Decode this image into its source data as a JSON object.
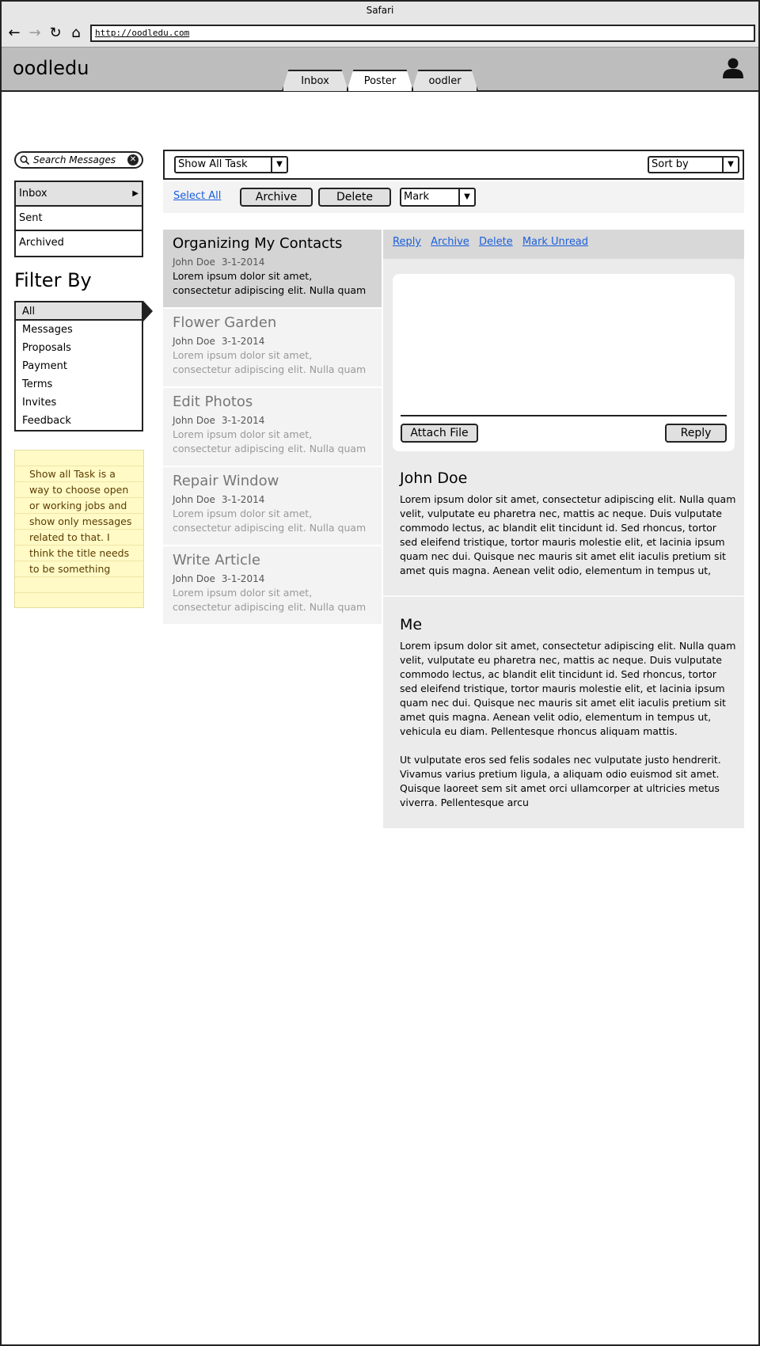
{
  "browser": {
    "window_title": "Safari",
    "url": "http://oodledu.com"
  },
  "app": {
    "logo": "oodledu",
    "tabs": [
      {
        "label": "Inbox"
      },
      {
        "label": "Poster"
      },
      {
        "label": "oodler"
      }
    ]
  },
  "sidebar": {
    "search_placeholder": "Search Messages",
    "folders": [
      {
        "label": "Inbox"
      },
      {
        "label": "Sent"
      },
      {
        "label": "Archived"
      }
    ],
    "filter_title": "Filter By",
    "filters": [
      "All",
      "Messages",
      "Proposals",
      "Payment",
      "Terms",
      "Invites",
      "Feedback"
    ],
    "note": "Show all Task is a way to choose open or working jobs and show only messages related to that. I think the title needs to be something"
  },
  "toolbar": {
    "task_filter": "Show All Task",
    "sort": "Sort by",
    "select_all": "Select All",
    "archive": "Archive",
    "delete": "Delete",
    "mark": "Mark"
  },
  "messages": [
    {
      "title": "Organizing My Contacts",
      "from": "John Doe",
      "date": "3-1-2014",
      "preview": "Lorem ipsum dolor sit amet, consectetur adipiscing elit. Nulla quam"
    },
    {
      "title": "Flower Garden",
      "from": "John Doe",
      "date": "3-1-2014",
      "preview": "Lorem ipsum dolor sit amet, consectetur adipiscing elit. Nulla quam"
    },
    {
      "title": "Edit Photos",
      "from": "John Doe",
      "date": "3-1-2014",
      "preview": "Lorem ipsum dolor sit amet, consectetur adipiscing elit. Nulla quam"
    },
    {
      "title": "Repair Window",
      "from": "John Doe",
      "date": "3-1-2014",
      "preview": "Lorem ipsum dolor sit amet, consectetur adipiscing elit. Nulla quam"
    },
    {
      "title": "Write Article",
      "from": "John Doe",
      "date": "3-1-2014",
      "preview": "Lorem ipsum dolor sit amet, consectetur adipiscing elit. Nulla quam"
    }
  ],
  "reading": {
    "actions": [
      "Reply",
      "Archive",
      "Delete",
      "Mark Unread"
    ],
    "attach_file": "Attach File",
    "reply": "Reply",
    "thread": [
      {
        "sender": "John Doe",
        "paragraphs": [
          "Lorem ipsum dolor sit amet, consectetur adipiscing elit. Nulla quam velit, vulputate eu pharetra nec, mattis ac neque. Duis vulputate commodo lectus, ac blandit elit tincidunt id. Sed rhoncus, tortor sed eleifend tristique, tortor mauris molestie elit, et lacinia ipsum quam nec dui. Quisque nec mauris sit amet elit iaculis pretium sit amet quis magna. Aenean velit odio, elementum in tempus ut,"
        ]
      },
      {
        "sender": "Me",
        "paragraphs": [
          "Lorem ipsum dolor sit amet, consectetur adipiscing elit. Nulla quam velit, vulputate eu pharetra nec, mattis ac neque. Duis vulputate commodo lectus, ac blandit elit tincidunt id. Sed rhoncus, tortor sed eleifend tristique, tortor mauris molestie elit, et lacinia ipsum quam nec dui. Quisque nec mauris sit amet elit iaculis pretium sit amet quis magna. Aenean velit odio, elementum in tempus ut, vehicula eu diam. Pellentesque rhoncus aliquam mattis.",
          "Ut vulputate eros sed felis sodales nec vulputate justo hendrerit. Vivamus varius pretium ligula, a aliquam odio euismod sit amet. Quisque laoreet sem sit amet orci ullamcorper at ultricies metus viverra. Pellentesque arcu"
        ]
      }
    ]
  },
  "colors": {
    "header_bg": "#bdbdbd",
    "link": "#1a5fdc",
    "note_bg": "#fffac6",
    "note_text": "#5b3c00"
  }
}
